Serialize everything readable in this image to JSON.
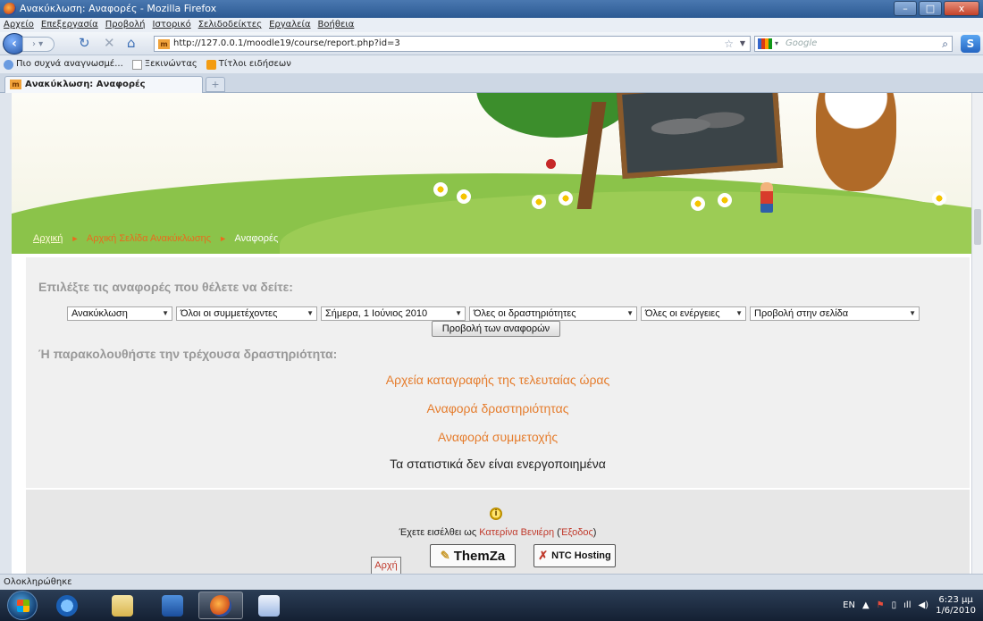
{
  "window": {
    "title": "Ανακύκλωση: Αναφορές - Mozilla Firefox",
    "controls": {
      "minimize": "–",
      "maximize": "□",
      "close": "x"
    }
  },
  "menubar": [
    "Αρχείο",
    "Επεξεργασία",
    "Προβολή",
    "Ιστορικό",
    "Σελιδοδείκτες",
    "Εργαλεία",
    "Βοήθεια"
  ],
  "nav": {
    "url": "http://127.0.0.1/moodle19/course/report.php?id=3",
    "search_placeholder": "Google"
  },
  "bookmarks": [
    "Πιο συχνά αναγνωσμέ...",
    "Ξεκινώντας",
    "Τίτλοι ειδήσεων"
  ],
  "tabs": [
    {
      "label": "Ανακύκλωση: Αναφορές"
    }
  ],
  "breadcrumb": {
    "home": "Αρχική",
    "course": "Αρχική Σελίδα Ανακύκλωσης",
    "current": "Αναφορές",
    "sep": "►"
  },
  "main": {
    "choose_heading": "Επιλέξτε τις αναφορές που θέλετε να δείτε:",
    "selects": [
      {
        "value": "Ανακύκλωση"
      },
      {
        "value": "Όλοι οι συμμετέχοντες"
      },
      {
        "value": "Σήμερα, 1 Ιούνιος 2010"
      },
      {
        "value": "Όλες οι δραστηριότητες"
      },
      {
        "value": "Όλες οι ενέργειες"
      },
      {
        "value": "Προβολή στην σελίδα"
      }
    ],
    "view_button": "Προβολή των αναφορών",
    "activity_heading": "Ή παρακολουθήστε την τρέχουσα δραστηριότητα:",
    "links": [
      "Αρχεία καταγραφής της τελευταίας ώρας",
      "Αναφορά δραστηριότητας",
      "Αναφορά συμμετοχής"
    ],
    "stats_disabled": "Τα στατιστικά δεν είναι ενεργοποιημένα"
  },
  "footer": {
    "logged_in_prefix": "Έχετε εισέλθει ως",
    "user": "Κατερίνα Βενιέρη",
    "logout": "Έξοδος",
    "home": "Αρχή",
    "logo1": "ThemZa",
    "logo2": "NTC Hosting"
  },
  "statusbar": "Ολοκληρώθηκε",
  "tray": {
    "lang": "EN",
    "time": "6:23 μμ",
    "date": "1/6/2010"
  }
}
